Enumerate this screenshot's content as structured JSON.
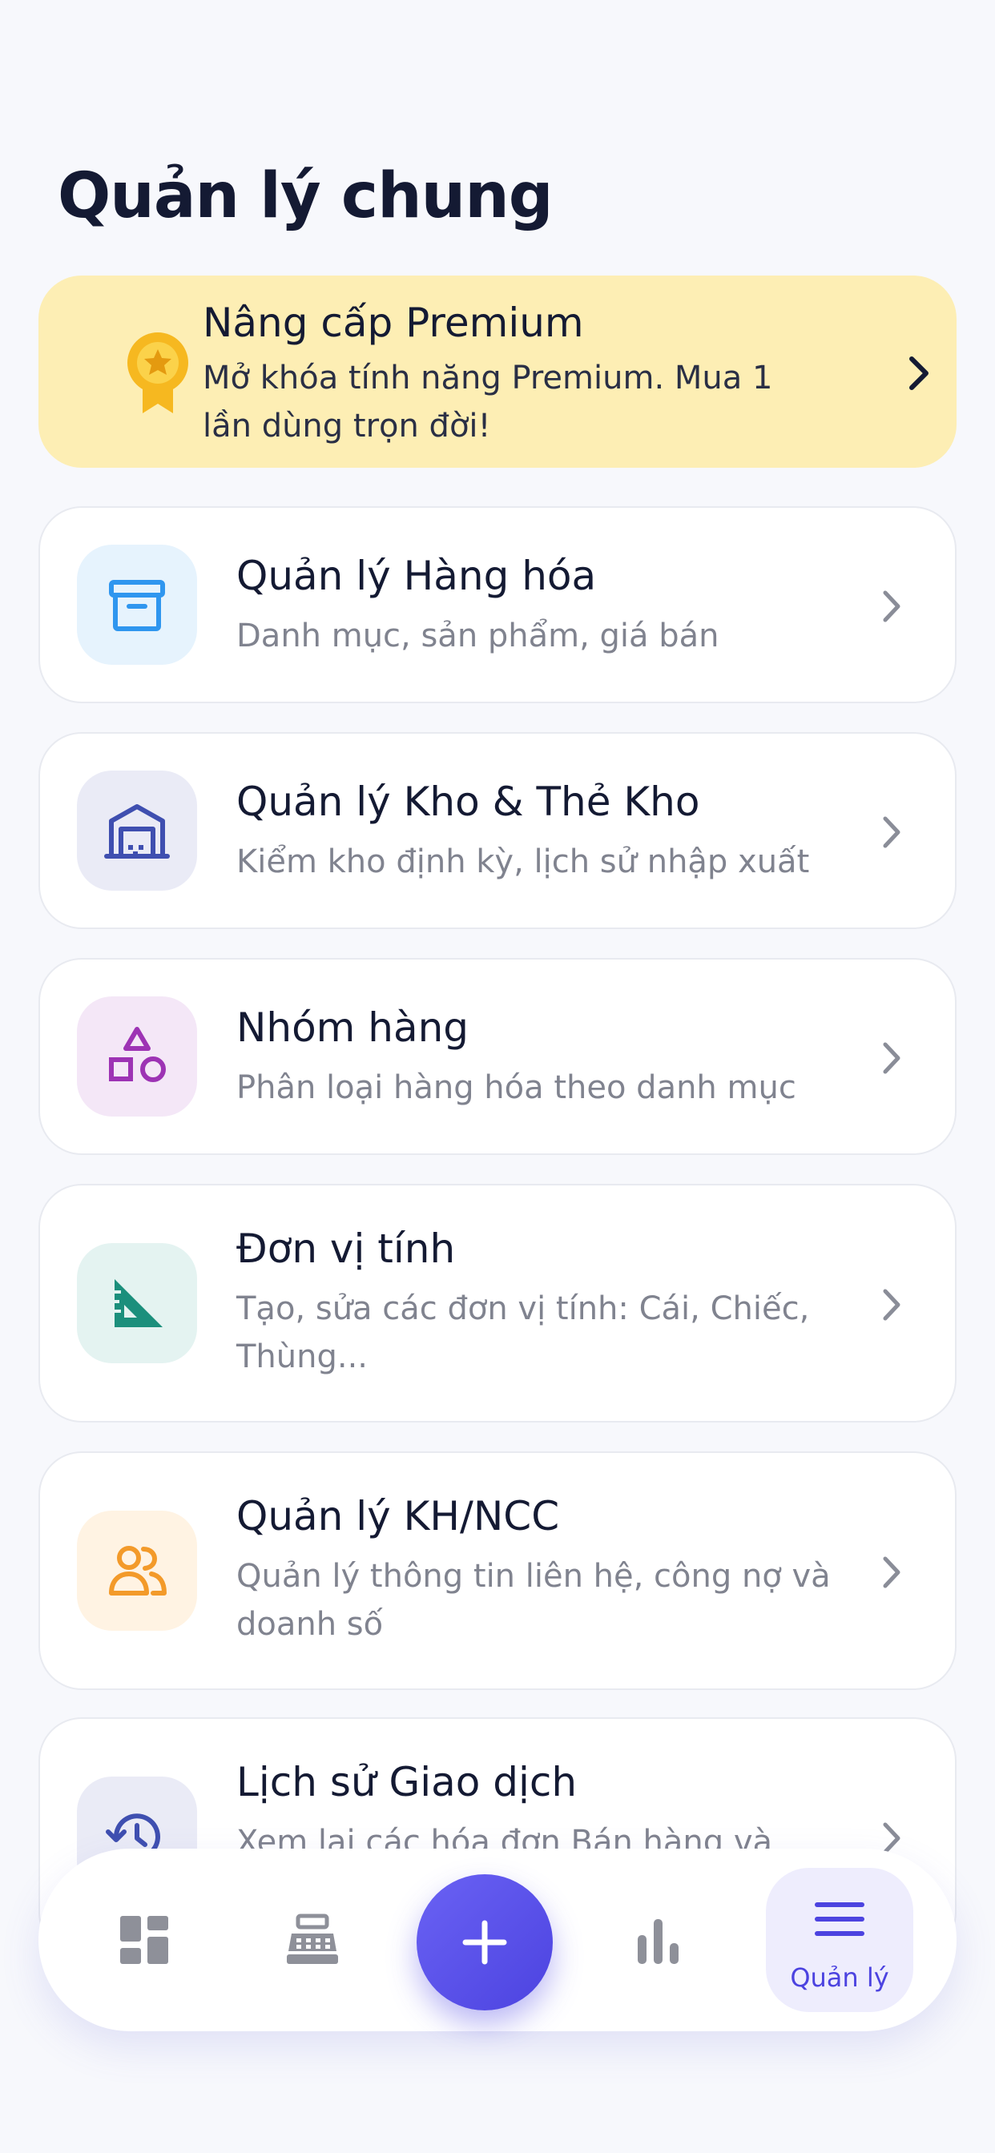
{
  "header": {
    "title": "Quản lý chung"
  },
  "premium": {
    "title": "Nâng cấp Premium",
    "subtitle": "Mở khóa tính năng Premium. Mua 1 lần dùng trọn đời!",
    "icon": "medal-icon",
    "color": "#fdeeb4"
  },
  "menu": {
    "items": [
      {
        "title": "Quản lý Hàng hóa",
        "subtitle": "Danh mục, sản phẩm, giá bán",
        "icon": "archive-box-icon",
        "color": "#2f96ef",
        "bg": "#e6f3fd"
      },
      {
        "title": "Quản lý Kho & Thẻ Kho",
        "subtitle": "Kiểm kho định kỳ, lịch sử nhập xuất",
        "icon": "warehouse-icon",
        "color": "#3f4fb0",
        "bg": "#eaebf6"
      },
      {
        "title": "Nhóm hàng",
        "subtitle": "Phân loại hàng hóa theo danh mục",
        "icon": "shapes-icon",
        "color": "#9d33b4",
        "bg": "#f4e7f7"
      },
      {
        "title": "Đơn vị tính",
        "subtitle": "Tạo, sửa các đơn vị tính: Cái, Chiếc, Thùng...",
        "icon": "set-square-icon",
        "color": "#1b8f7c",
        "bg": "#e4f3f1"
      },
      {
        "title": "Quản lý KH/NCC",
        "subtitle": "Quản lý thông tin liên hệ, công nợ và doanh số",
        "icon": "people-icon",
        "color": "#f39a2a",
        "bg": "#fff3e3"
      },
      {
        "title": "Lịch sử Giao dịch",
        "subtitle": "Xem lại các hóa đơn Bán hàng và",
        "icon": "history-icon",
        "color": "#3f4fb0",
        "bg": "#eaebf6"
      }
    ]
  },
  "bottom_nav": {
    "items": [
      {
        "icon": "dashboard-icon"
      },
      {
        "icon": "cash-register-icon"
      },
      {
        "icon": "plus-icon"
      },
      {
        "icon": "bar-chart-icon"
      },
      {
        "icon": "menu-icon",
        "label": "Quản lý"
      }
    ],
    "active_index": 4,
    "accent": "#4c43e0"
  }
}
